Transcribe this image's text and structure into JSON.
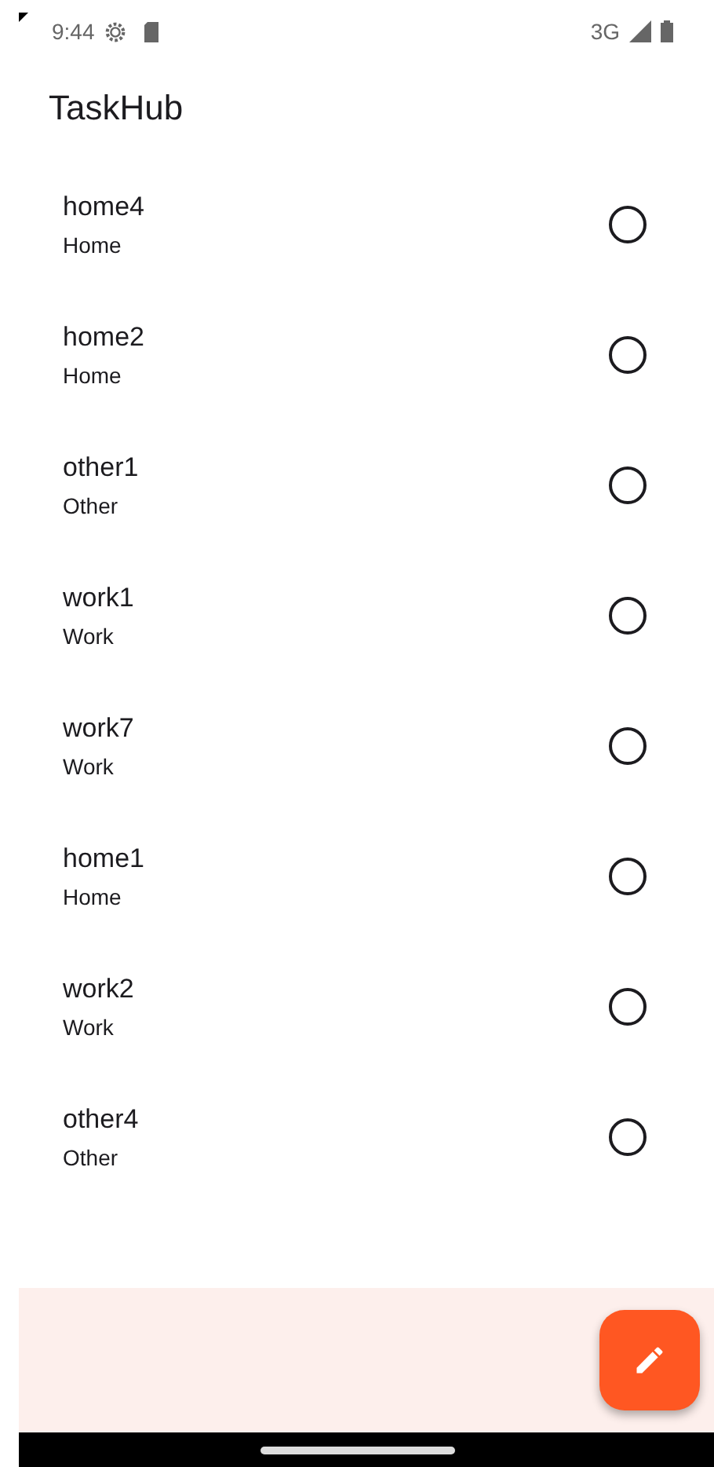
{
  "status_bar": {
    "time": "9:44",
    "network": "3G"
  },
  "app_bar": {
    "title": "TaskHub"
  },
  "tasks": [
    {
      "title": "home4",
      "category": "Home",
      "checked": false
    },
    {
      "title": "home2",
      "category": "Home",
      "checked": false
    },
    {
      "title": "other1",
      "category": "Other",
      "checked": false
    },
    {
      "title": "work1",
      "category": "Work",
      "checked": false
    },
    {
      "title": "work7",
      "category": "Work",
      "checked": false
    },
    {
      "title": "home1",
      "category": "Home",
      "checked": false
    },
    {
      "title": "work2",
      "category": "Work",
      "checked": false
    },
    {
      "title": "other4",
      "category": "Other",
      "checked": false
    }
  ]
}
